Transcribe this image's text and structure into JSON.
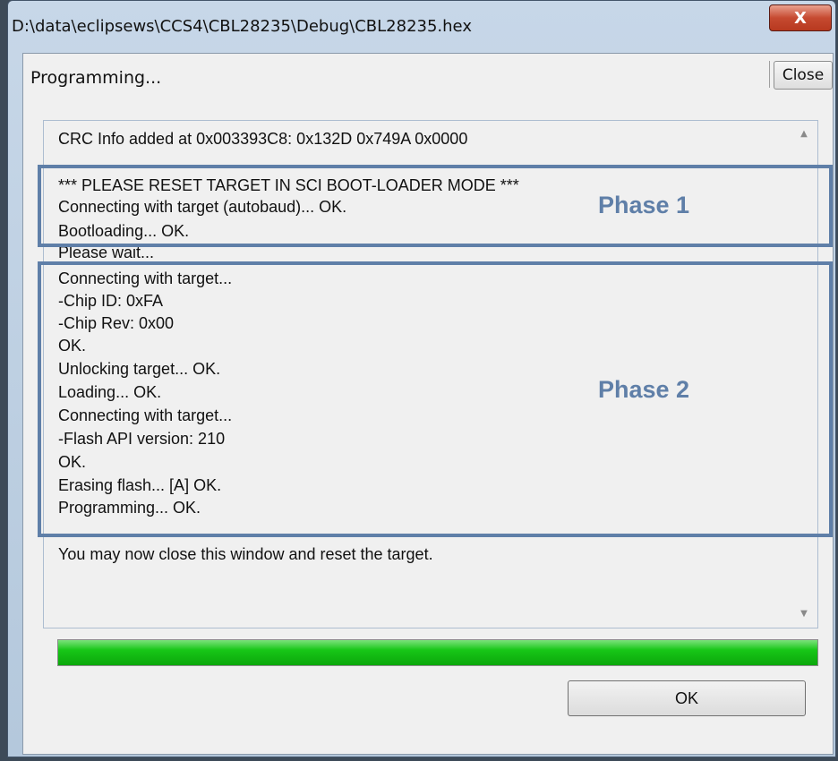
{
  "window": {
    "title": "D:\\data\\eclipsews\\CCS4\\CBL28235\\Debug\\CBL28235.hex",
    "close_glyph": "X"
  },
  "status": {
    "label": "Programming...",
    "close_button": "Close"
  },
  "log": {
    "lines": [
      "CRC Info added at 0x003393C8: 0x132D 0x749A 0x0000",
      "",
      "*** PLEASE RESET TARGET IN SCI BOOT-LOADER MODE ***",
      "Connecting with target (autobaud)...  OK.",
      "Bootloading...  OK.",
      "Please wait...",
      "Connecting with target...",
      "-Chip ID: 0xFA",
      "-Chip Rev: 0x00",
      " OK.",
      "Unlocking target...  OK.",
      "Loading...  OK.",
      "Connecting with target...",
      "-Flash API version: 210",
      " OK.",
      "Erasing flash... [A] OK.",
      "Programming...  OK.",
      "",
      "You may now close this window and reset the target."
    ]
  },
  "annotations": {
    "phase1_label": "Phase 1",
    "phase2_label": "Phase 2",
    "box_color": "#5f7fa8"
  },
  "progress": {
    "percent": 100,
    "color": "#14c014"
  },
  "buttons": {
    "ok_label": "OK"
  },
  "icons": {
    "scroll_up": "scroll-up-arrow-icon",
    "scroll_down": "scroll-down-arrow-icon",
    "close": "close-x-icon"
  }
}
